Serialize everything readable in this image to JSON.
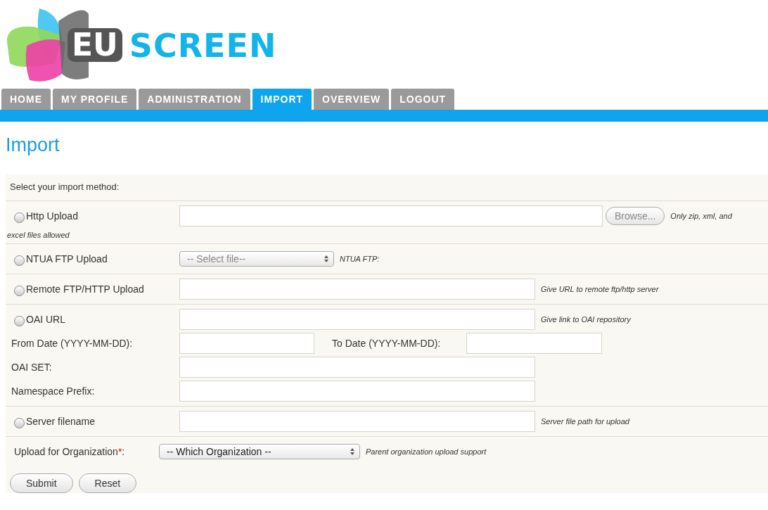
{
  "logo": {
    "first": "EU",
    "second": "SCREEN"
  },
  "tabs": [
    {
      "label": "HOME",
      "selected": false
    },
    {
      "label": "MY PROFILE",
      "selected": false
    },
    {
      "label": "ADMINISTRATION",
      "selected": false
    },
    {
      "label": "IMPORT",
      "selected": true
    },
    {
      "label": "OVERVIEW",
      "selected": false
    },
    {
      "label": "LOGOUT",
      "selected": false
    }
  ],
  "title": "Import",
  "intro": "Select your import method:",
  "methods": [
    {
      "kind": "file",
      "label": "Http Upload",
      "selected": false,
      "button": "Browse...",
      "hint_lines": [
        "Only zip, xml, and",
        "excel files allowed"
      ]
    },
    {
      "kind": "select",
      "label": "NTUA FTP Upload",
      "selected": false,
      "value": "-- Select file--",
      "hint": "NTUA FTP:"
    },
    {
      "kind": "text",
      "label": "Remote FTP/HTTP Upload",
      "selected": false,
      "hint": "Give URL to remote ftp/http server"
    },
    {
      "kind": "oai",
      "label": "OAI URL",
      "selected": false,
      "hint": "Give link to OAI repository",
      "from_label": "From Date (YYYY-MM-DD):",
      "to_label": "To Date (YYYY-MM-DD):",
      "extra_fields": [
        "OAI SET:",
        "Namespace Prefix:"
      ]
    },
    {
      "kind": "text",
      "label": "Server filename",
      "selected": false,
      "hint": "Server file path for upload"
    }
  ],
  "organization": {
    "label": "Upload for Organization",
    "required_mark": "*",
    "label_end": ":",
    "value": "-- Which Organization --",
    "hint": "Parent organization upload support"
  },
  "buttons": [
    "Submit",
    "Reset"
  ]
}
